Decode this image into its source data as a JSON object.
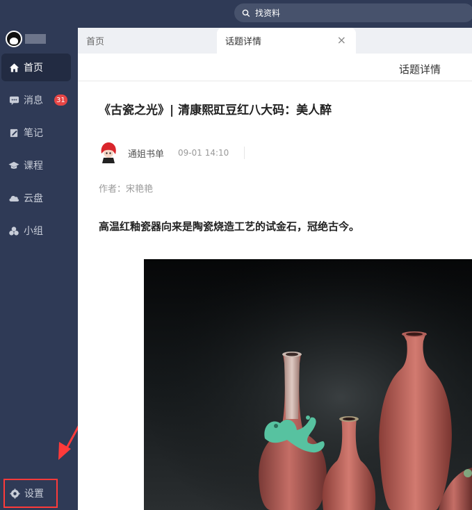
{
  "search": {
    "placeholder": "找资料",
    "icon": "search-icon"
  },
  "sidebar": {
    "items": [
      {
        "label": "首页",
        "icon": "home-icon",
        "active": true
      },
      {
        "label": "消息",
        "icon": "message-icon",
        "badge": "31"
      },
      {
        "label": "笔记",
        "icon": "note-icon"
      },
      {
        "label": "课程",
        "icon": "graduation-cap-icon"
      },
      {
        "label": "云盘",
        "icon": "cloud-icon"
      },
      {
        "label": "小组",
        "icon": "group-icon"
      }
    ],
    "settings_label": "设置"
  },
  "tabs": [
    {
      "label": "首页"
    },
    {
      "label": "话题详情",
      "active": true,
      "close": "×"
    }
  ],
  "page": {
    "header": "话题详情"
  },
  "article": {
    "title": "《古瓷之光》| 清康熙豇豆红八大码：美人醉",
    "author": "通姐书单",
    "time": "09-01 14:10",
    "byline": "作者：宋艳艳",
    "lead": "高温红釉瓷器向来是陶瓷烧造工艺的试金石，冠绝古今。"
  },
  "colors": {
    "sidebar_bg": "#2f3a56",
    "active_bg": "#222b42",
    "badge": "#e64545",
    "highlight": "#ff3a3a"
  }
}
